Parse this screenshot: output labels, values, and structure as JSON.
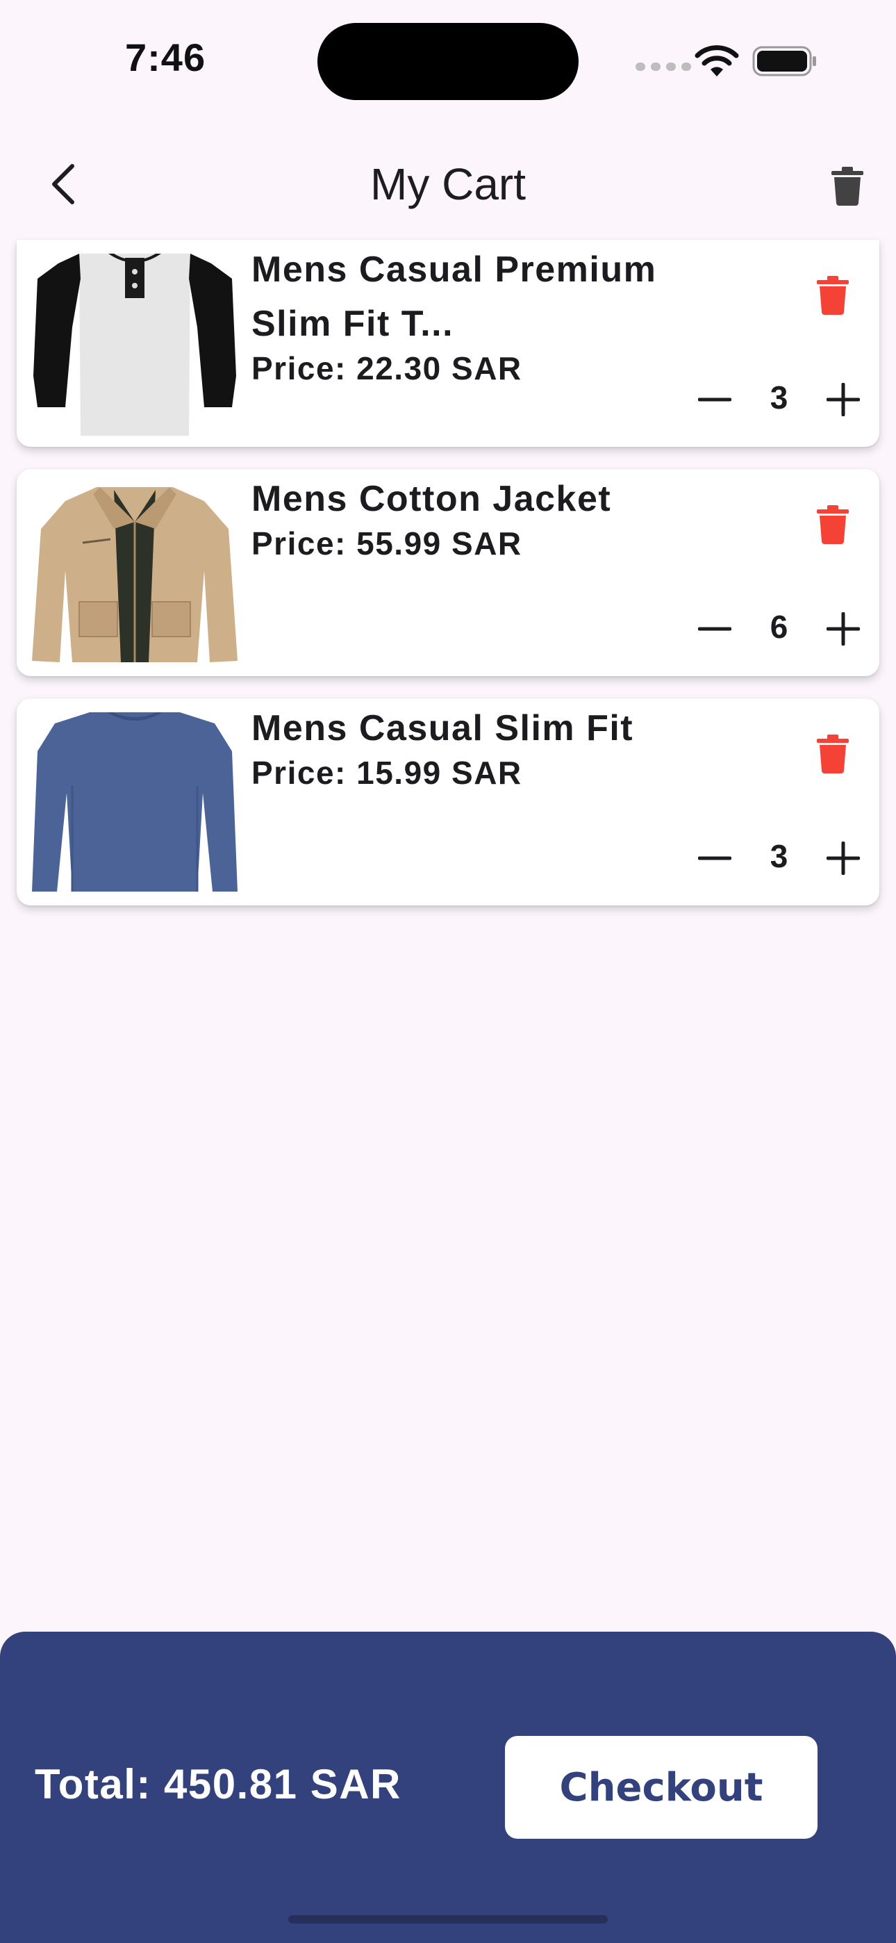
{
  "status_bar": {
    "time": "7:46",
    "icons": [
      "signal-dots-icon",
      "wifi-icon",
      "battery-icon"
    ]
  },
  "app_bar": {
    "title": "My Cart",
    "back_icon": "chevron-left-icon",
    "clear_icon": "trash-icon"
  },
  "cart": {
    "items": [
      {
        "title": "Mens Casual Premium Slim Fit T...",
        "price": "Price: 22.30 SAR",
        "quantity": "3",
        "image": "raglan-tshirt"
      },
      {
        "title": "Mens Cotton Jacket",
        "price": "Price: 55.99 SAR",
        "quantity": "6",
        "image": "cotton-jacket"
      },
      {
        "title": "Mens Casual Slim Fit",
        "price": "Price: 15.99 SAR",
        "quantity": "3",
        "image": "longsleeve-shirt"
      }
    ]
  },
  "footer": {
    "total": "Total: 450.81 SAR",
    "checkout_label": "Checkout"
  },
  "colors": {
    "background": "#fcf6fc",
    "primary": "#33427c",
    "delete": "#f44336",
    "card": "#ffffff"
  }
}
